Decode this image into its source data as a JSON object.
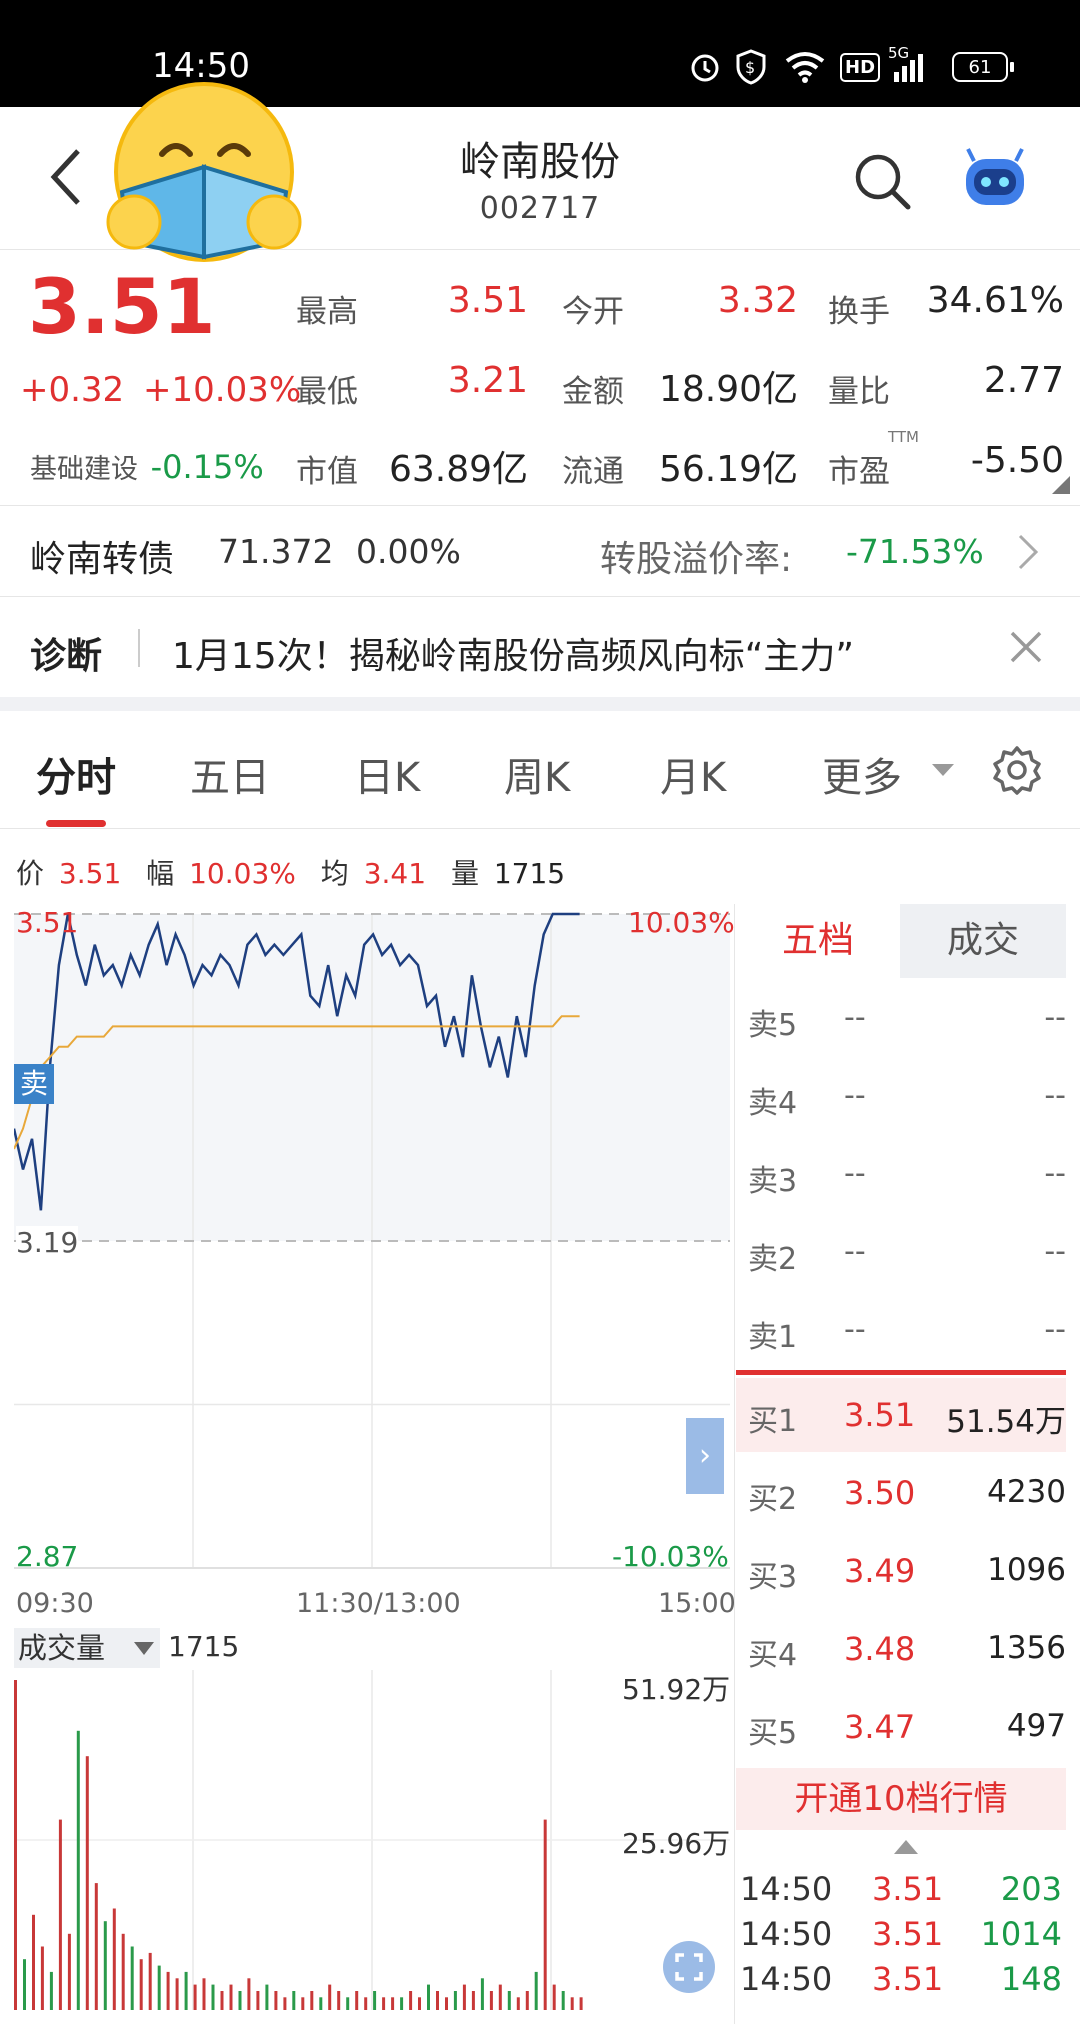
{
  "status": {
    "time": "14:50",
    "battery": "61",
    "net_hd": "HD",
    "net_5g": "5G"
  },
  "header": {
    "name": "岭南股份",
    "code": "002717"
  },
  "quote": {
    "price": "3.51",
    "change": "+0.32",
    "pct": "+10.03%",
    "stats": [
      {
        "label": "最高",
        "value": "3.51",
        "color": "red"
      },
      {
        "label": "今开",
        "value": "3.32",
        "color": "red"
      },
      {
        "label": "换手",
        "value": "34.61%",
        "color": "dark"
      },
      {
        "label": "最低",
        "value": "3.21",
        "color": "red"
      },
      {
        "label": "金额",
        "value": "18.90亿",
        "color": "dark"
      },
      {
        "label": "量比",
        "value": "2.77",
        "color": "dark"
      },
      {
        "label": "市值",
        "value": "63.89亿",
        "color": "dark"
      },
      {
        "label": "流通",
        "value": "56.19亿",
        "color": "dark"
      },
      {
        "label": "市盈",
        "value": "-5.50",
        "color": "dark"
      }
    ],
    "ttm": "TTM",
    "sector_label": "基础建设",
    "sector_change": "-0.15%"
  },
  "bond": {
    "name": "岭南转债",
    "price": "71.372",
    "change": "0.00%",
    "premium_label": "转股溢价率:",
    "premium": "-71.53%"
  },
  "diagnosis": {
    "tag": "诊断",
    "text": "1月15次！揭秘岭南股份高频风向标“主力”"
  },
  "tabs": [
    "分时",
    "五日",
    "日K",
    "周K",
    "月K",
    "更多"
  ],
  "chart_info": {
    "price_label": "价",
    "price": "3.51",
    "amp_label": "幅",
    "amp": "10.03%",
    "avg_label": "均",
    "avg": "3.41",
    "vol_label": "量",
    "vol": "1715"
  },
  "chart_data": {
    "type": "line",
    "x_start": "09:30",
    "x_mid": "11:30/13:00",
    "x_end": "15:00",
    "y_top": "3.51",
    "y_mid": "3.19",
    "y_bottom": "2.87",
    "pct_top": "10.03%",
    "pct_bottom": "-10.03%",
    "ylim": [
      2.87,
      3.51
    ],
    "series": [
      {
        "values": [
          3.3,
          3.26,
          3.29,
          3.22,
          3.36,
          3.46,
          3.51,
          3.47,
          3.44,
          3.48,
          3.45,
          3.46,
          3.44,
          3.47,
          3.45,
          3.48,
          3.5,
          3.46,
          3.49,
          3.47,
          3.44,
          3.46,
          3.45,
          3.47,
          3.46,
          3.44,
          3.48,
          3.49,
          3.47,
          3.48,
          3.47,
          3.48,
          3.49,
          3.43,
          3.42,
          3.46,
          3.41,
          3.45,
          3.43,
          3.48,
          3.49,
          3.47,
          3.48,
          3.46,
          3.47,
          3.46,
          3.42,
          3.43,
          3.38,
          3.41,
          3.37,
          3.45,
          3.4,
          3.36,
          3.39,
          3.35,
          3.41,
          3.37,
          3.44,
          3.49,
          3.51,
          3.51,
          3.51,
          3.51
        ]
      },
      {
        "values": [
          3.28,
          3.3,
          3.33,
          3.36,
          3.37,
          3.38,
          3.38,
          3.39,
          3.39,
          3.39,
          3.39,
          3.4,
          3.4,
          3.4,
          3.4,
          3.4,
          3.4,
          3.4,
          3.4,
          3.4,
          3.4,
          3.4,
          3.4,
          3.4,
          3.4,
          3.4,
          3.4,
          3.4,
          3.4,
          3.4,
          3.4,
          3.4,
          3.4,
          3.4,
          3.4,
          3.4,
          3.4,
          3.4,
          3.4,
          3.4,
          3.4,
          3.4,
          3.4,
          3.4,
          3.4,
          3.4,
          3.4,
          3.4,
          3.4,
          3.4,
          3.4,
          3.4,
          3.4,
          3.4,
          3.4,
          3.4,
          3.4,
          3.4,
          3.4,
          3.4,
          3.4,
          3.41,
          3.41,
          3.41
        ]
      }
    ],
    "sell_marker": "卖",
    "volume_label": "成交量",
    "volume_value": "1715",
    "volume_max": "51.92万",
    "volume_mid": "25.96万",
    "volumes": [
      52,
      8,
      15,
      10,
      6,
      30,
      12,
      44,
      40,
      20,
      14,
      16,
      12,
      10,
      8,
      9,
      7,
      6,
      5,
      6,
      4,
      5,
      4,
      3,
      4,
      3,
      5,
      3,
      4,
      3,
      2,
      3,
      2,
      3,
      2,
      4,
      3,
      2,
      3,
      2,
      3,
      2,
      2,
      2,
      3,
      2,
      4,
      3,
      2,
      3,
      4,
      3,
      5,
      3,
      4,
      3,
      2,
      3,
      6,
      30,
      4,
      3,
      2,
      2
    ]
  },
  "orderbook": {
    "tab_active": "五档",
    "tab_other": "成交",
    "sells": [
      {
        "label": "卖5",
        "price": "--",
        "vol": "--"
      },
      {
        "label": "卖4",
        "price": "--",
        "vol": "--"
      },
      {
        "label": "卖3",
        "price": "--",
        "vol": "--"
      },
      {
        "label": "卖2",
        "price": "--",
        "vol": "--"
      },
      {
        "label": "卖1",
        "price": "--",
        "vol": "--"
      }
    ],
    "buys": [
      {
        "label": "买1",
        "price": "3.51",
        "vol": "51.54万"
      },
      {
        "label": "买2",
        "price": "3.50",
        "vol": "4230"
      },
      {
        "label": "买3",
        "price": "3.49",
        "vol": "1096"
      },
      {
        "label": "买4",
        "price": "3.48",
        "vol": "1356"
      },
      {
        "label": "买5",
        "price": "3.47",
        "vol": "497"
      }
    ],
    "upgrade": "开通10档行情",
    "trades": [
      {
        "time": "14:50",
        "price": "3.51",
        "vol": "203"
      },
      {
        "time": "14:50",
        "price": "3.51",
        "vol": "1014"
      },
      {
        "time": "14:50",
        "price": "3.51",
        "vol": "148"
      }
    ]
  }
}
